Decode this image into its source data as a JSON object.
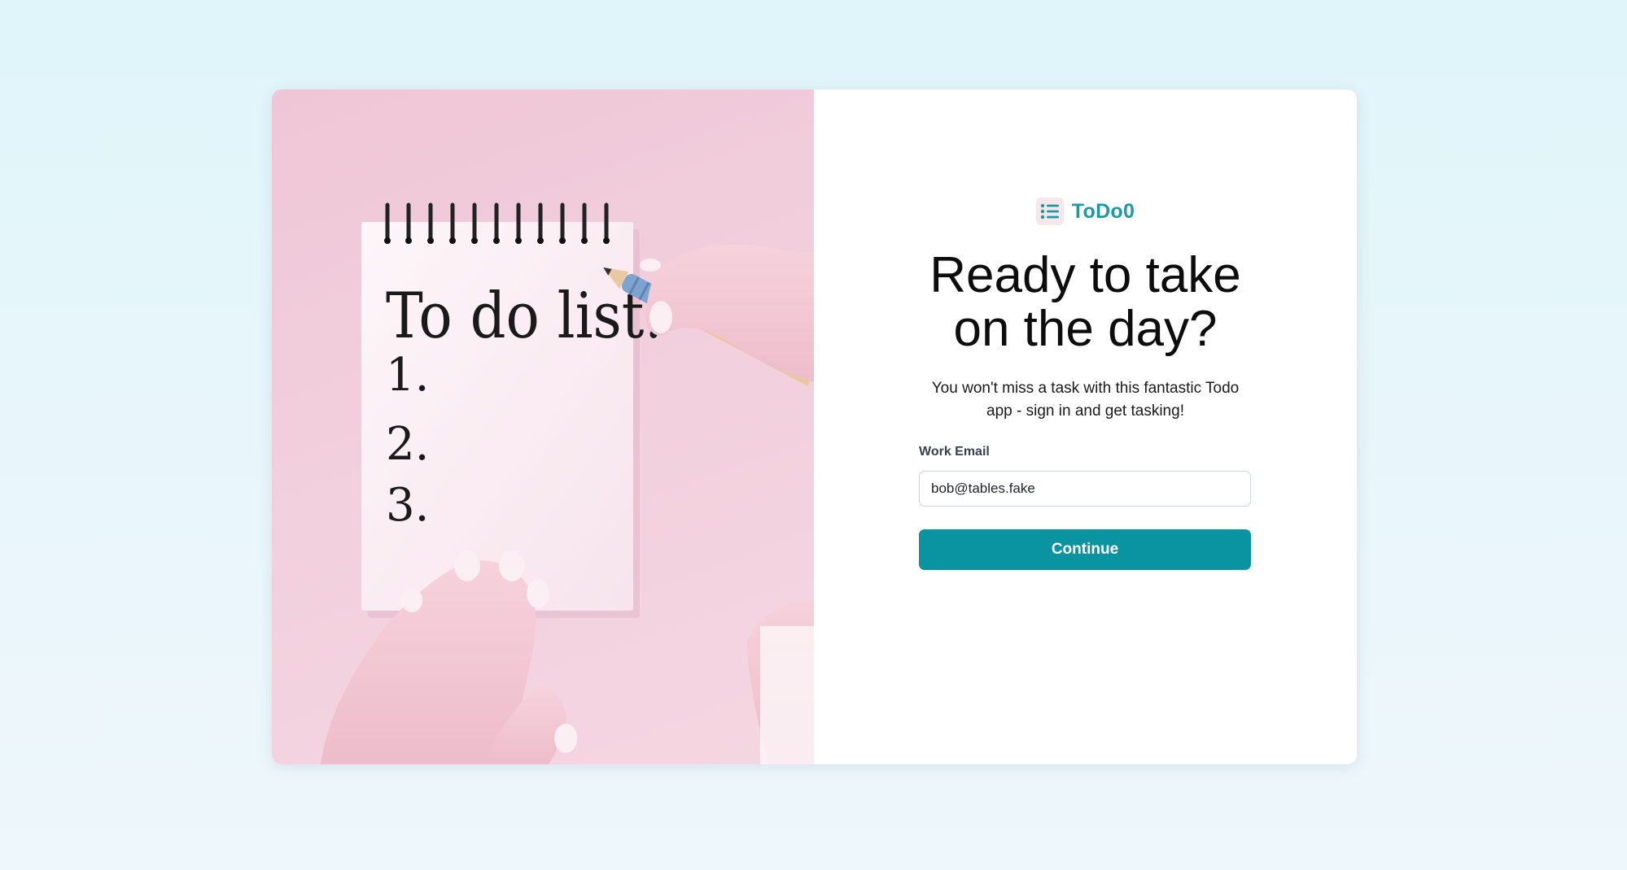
{
  "hero": {
    "image_description_icon": "notebook-illustration",
    "notebook": {
      "heading": "To do list:",
      "items": [
        "1.",
        "2.",
        "3."
      ]
    }
  },
  "brand": {
    "icon": "list-icon",
    "name": "ToDo0"
  },
  "headline": {
    "line1": "Ready to take",
    "line2": "on the day?"
  },
  "subtitle": "You won't miss a task with this fantastic Todo app - sign in and get tasking!",
  "form": {
    "email_label": "Work Email",
    "email_value": "bob@tables.fake",
    "continue_label": "Continue"
  },
  "colors": {
    "accent": "#0a93a0",
    "brand_text": "#1b9aa6",
    "hero_pink": "#efc6d6"
  }
}
